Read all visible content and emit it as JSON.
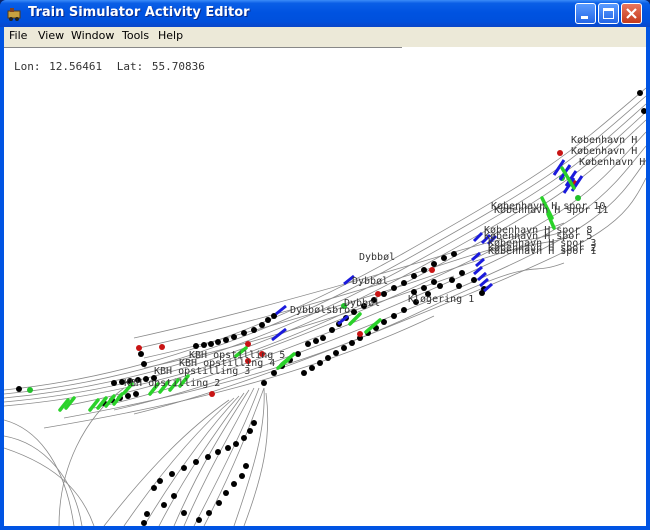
{
  "window": {
    "title": "Train Simulator Activity Editor"
  },
  "menu": {
    "items": [
      "File",
      "View",
      "Window",
      "Tools",
      "Help"
    ]
  },
  "coords": {
    "lon_label": "Lon:",
    "lon": "12.56461",
    "lat_label": "Lat:",
    "lat": "55.70836"
  },
  "map_labels": [
    "København H",
    "København H",
    "København H",
    "København H spor 11",
    "København H spor 10",
    "København H spor 8",
    "København H spor 5",
    "København H spor 3",
    "København H spor 2",
    "København H spor 1",
    "Dybbøl",
    "Dybbøl",
    "Dybbøl",
    "Dybbølsbro",
    "Kløgering 1",
    "KBH opstilling 5",
    "KBH opstilling 4",
    "KBH opstilling 3",
    "KBH opstilling 2"
  ],
  "colors": {
    "titlebar": "#0054e3",
    "track": "#8a8a8a",
    "node_black": "#000000",
    "node_red": "#c81414",
    "node_green": "#22c02a",
    "marker_blue": "#1a1adc",
    "marker_green": "#2ad22a"
  }
}
